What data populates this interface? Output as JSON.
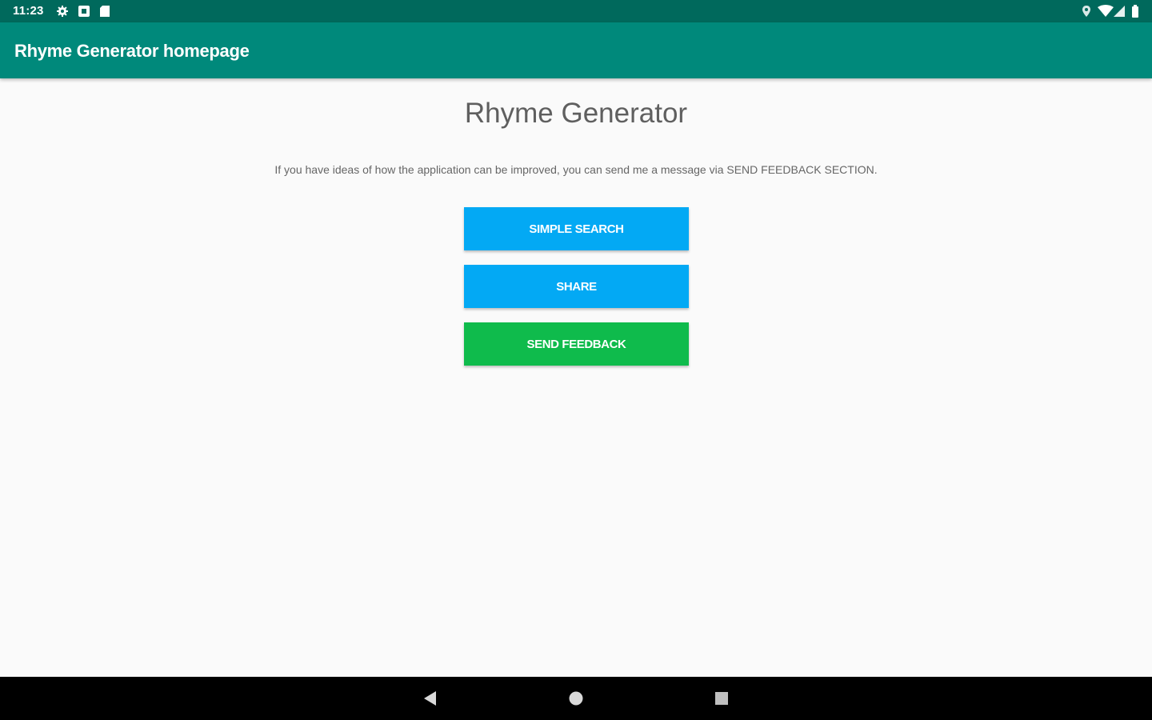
{
  "status_bar": {
    "time": "11:23",
    "left_icons": [
      "settings-icon",
      "notification-icon",
      "sd-card-icon"
    ],
    "right_icons": [
      "location-icon",
      "wifi-icon",
      "signal-icon",
      "battery-icon"
    ]
  },
  "app_bar": {
    "title": "Rhyme Generator homepage"
  },
  "main": {
    "title": "Rhyme Generator",
    "description": "If you have ideas of how the application can be improved, you can send me a message via SEND FEEDBACK SECTION.",
    "buttons": {
      "simple_search": "SIMPLE SEARCH",
      "share": "SHARE",
      "send_feedback": "SEND FEEDBACK"
    }
  },
  "nav_bar": {
    "buttons": [
      "back-icon",
      "home-icon",
      "recents-icon"
    ]
  },
  "colors": {
    "status_bar": "#00695c",
    "app_bar": "#00897b",
    "primary_button": "#03a9f4",
    "feedback_button": "#0fbb4c",
    "background": "#fafafa"
  }
}
